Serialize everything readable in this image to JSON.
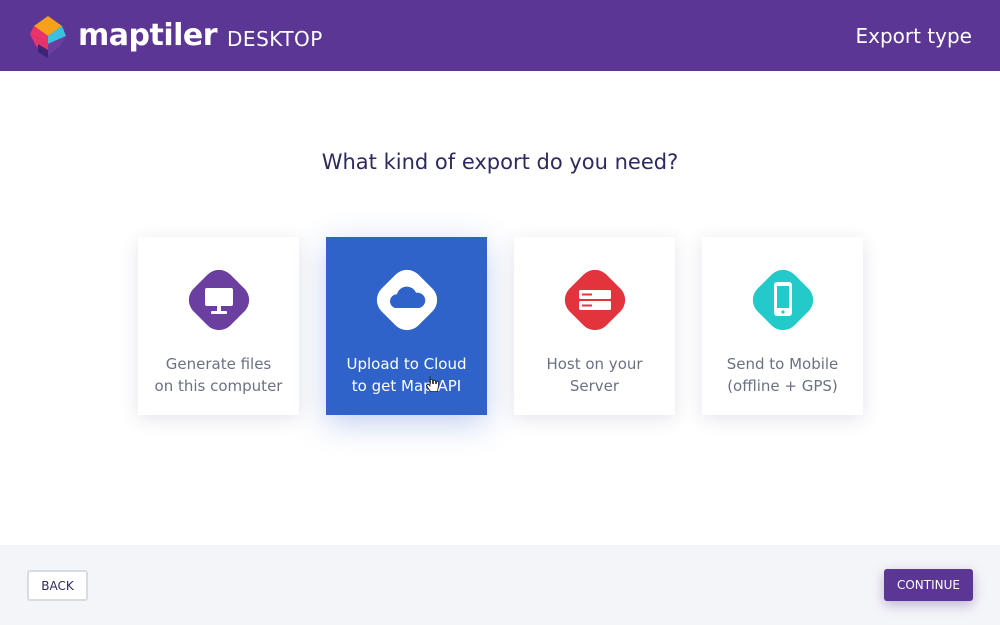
{
  "header": {
    "brand_name": "maptiler",
    "brand_sub": "DESKTOP",
    "title": "Export type"
  },
  "question": "What kind of export do you need?",
  "cards": [
    {
      "line1": "Generate files",
      "line2": "on this computer",
      "icon": "monitor-icon",
      "color": "#6b3fa0",
      "selected": false
    },
    {
      "line1": "Upload to Cloud",
      "line2": "to get Map API",
      "icon": "cloud-icon",
      "color": "#ffffff",
      "selected": true
    },
    {
      "line1": "Host on your",
      "line2": "Server",
      "icon": "server-icon",
      "color": "#e3343e",
      "selected": false
    },
    {
      "line1": "Send to Mobile",
      "line2": "(offline + GPS)",
      "icon": "phone-icon",
      "color": "#24c9c9",
      "selected": false
    }
  ],
  "footer": {
    "back_label": "BACK",
    "continue_label": "CONTINUE"
  },
  "colors": {
    "brand": "#5b3694",
    "selected_card": "#2f63c9"
  }
}
